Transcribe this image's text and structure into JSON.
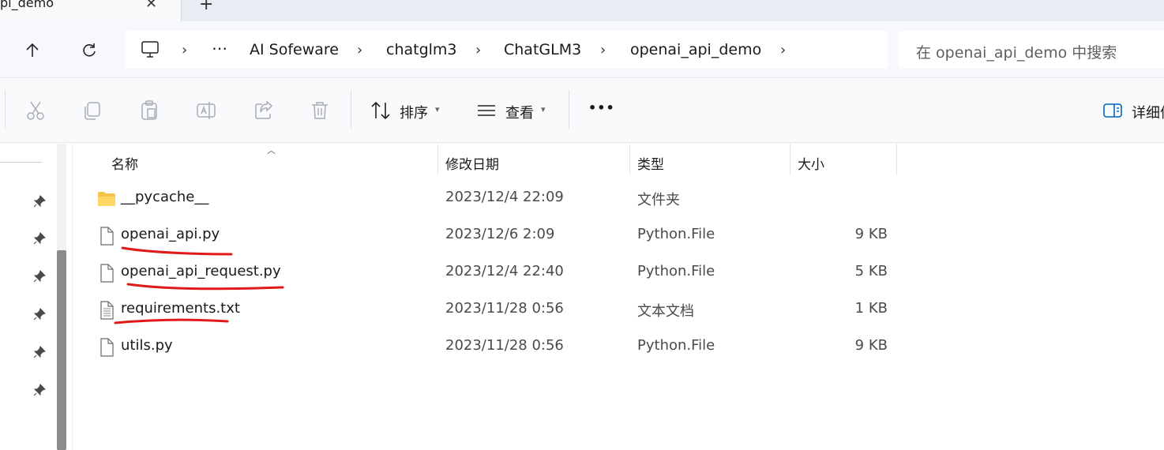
{
  "tab": {
    "title": "pi_demo",
    "close": "✕",
    "new": "+"
  },
  "nav": {
    "breadcrumb": [
      {
        "label": "AI Sofeware"
      },
      {
        "label": "chatglm3"
      },
      {
        "label": "ChatGLM3"
      },
      {
        "label": "openai_api_demo"
      }
    ],
    "overflow": "⋯",
    "search_placeholder": "在 openai_api_demo 中搜索"
  },
  "toolbar": {
    "sort_label": "排序",
    "view_label": "查看",
    "more": "•••",
    "details_label": "详细信"
  },
  "columns": {
    "name": "名称",
    "date": "修改日期",
    "type": "类型",
    "size": "大小"
  },
  "files": [
    {
      "name": "__pycache__",
      "date": "2023/12/4 22:09",
      "type": "文件夹",
      "size": "",
      "icon": "folder-icon"
    },
    {
      "name": "openai_api.py",
      "date": "2023/12/6 2:09",
      "type": "Python.File",
      "size": "9 KB",
      "icon": "file-icon"
    },
    {
      "name": "openai_api_request.py",
      "date": "2023/12/4 22:40",
      "type": "Python.File",
      "size": "5 KB",
      "icon": "file-icon"
    },
    {
      "name": "requirements.txt",
      "date": "2023/11/28 0:56",
      "type": "文本文档",
      "size": "1 KB",
      "icon": "text-file-icon"
    },
    {
      "name": "utils.py",
      "date": "2023/11/28 0:56",
      "type": "Python.File",
      "size": "9 KB",
      "icon": "file-icon"
    }
  ],
  "colors": {
    "annotation": "#e01919",
    "folder": "#f5c24a",
    "accent": "#0067c0"
  }
}
